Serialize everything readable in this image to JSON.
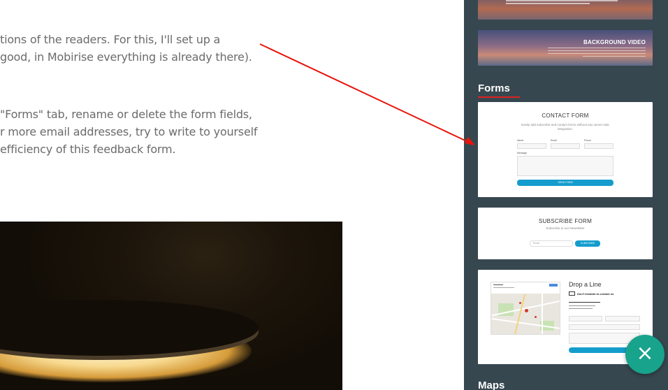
{
  "article": {
    "para1_line1": "tions of the readers. For this, I'll set up a",
    "para1_line2": "good, in Mobirise everything is already there).",
    "para2_line1": "\"Forms\" tab, rename or delete the form fields,",
    "para2_line2": "r more email addresses, try to write to yourself",
    "para2_line3": "efficiency of this feedback form."
  },
  "panel": {
    "video_block_title": "BACKGROUND VIDEO",
    "forms_section_title": "Forms",
    "next_section_title": "Maps",
    "contact_form": {
      "title": "CONTACT FORM",
      "subtitle_line1": "Easily add subscribe and contact forms without any server-side",
      "subtitle_line2": "integration.",
      "label_name": "Name",
      "label_email": "Email",
      "label_phone": "Phone",
      "label_message": "Message",
      "button": "SEND FORM"
    },
    "subscribe_form": {
      "title": "SUBSCRIBE FORM",
      "subtitle": "Subscribe to our Newsletter",
      "placeholder": "Email",
      "button": "SUBSCRIBE"
    },
    "drop_line": {
      "title": "Drop a Line",
      "tagline": "Don't hesitate to contact us"
    }
  },
  "fab": {
    "icon": "close-icon",
    "symbol": "×",
    "color": "#18a38c"
  },
  "colors": {
    "panel_bg": "#37474f",
    "accent_red": "#e02020",
    "button_blue": "#149dcc"
  }
}
